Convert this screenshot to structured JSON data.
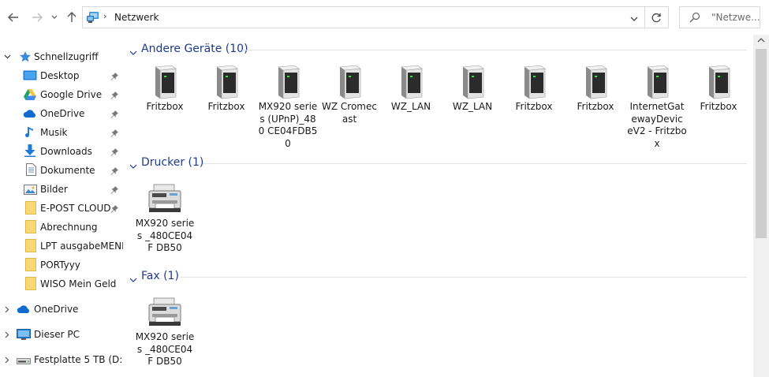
{
  "address_bar": {
    "path": "Netzwerk",
    "search_placeholder": "\"Netzwe..."
  },
  "sidebar": {
    "quick_access": "Schnellzugriff",
    "items": [
      {
        "label": "Desktop",
        "icon": "desktop-icon",
        "pinned": true
      },
      {
        "label": "Google Drive",
        "icon": "google-drive-icon",
        "pinned": true
      },
      {
        "label": "OneDrive",
        "icon": "onedrive-cloud-icon",
        "pinned": true
      },
      {
        "label": "Musik",
        "icon": "music-note-icon",
        "pinned": true
      },
      {
        "label": "Downloads",
        "icon": "download-arrow-icon",
        "pinned": true
      },
      {
        "label": "Dokumente",
        "icon": "document-icon",
        "pinned": true
      },
      {
        "label": "Bilder",
        "icon": "pictures-icon",
        "pinned": true
      },
      {
        "label": "E-POST CLOUD",
        "icon": "folder-icon",
        "pinned": true
      },
      {
        "label": "Abrechnung",
        "icon": "folder-icon",
        "pinned": false
      },
      {
        "label": "LPT ausgabeMENE1",
        "icon": "folder-icon",
        "pinned": false
      },
      {
        "label": "PORTyyy",
        "icon": "folder-icon",
        "pinned": false
      },
      {
        "label": "WISO Mein Geld",
        "icon": "folder-icon",
        "pinned": false
      }
    ],
    "roots": [
      {
        "label": "OneDrive",
        "icon": "onedrive-cloud-icon"
      },
      {
        "label": "Dieser PC",
        "icon": "computer-icon"
      },
      {
        "label": "Festplatte 5 TB (D:)",
        "icon": "drive-icon"
      }
    ]
  },
  "groups": [
    {
      "title": "Andere Geräte (10)",
      "items": [
        {
          "label": "Fritzbox",
          "icon": "network-device-icon"
        },
        {
          "label": "Fritzbox",
          "icon": "network-device-icon"
        },
        {
          "label": "MX920 series (UPnP)_480 CE04FDB50",
          "icon": "network-device-icon"
        },
        {
          "label": "WZ Cromecast",
          "icon": "network-device-icon"
        },
        {
          "label": "WZ_LAN",
          "icon": "network-device-icon"
        },
        {
          "label": "WZ_LAN",
          "icon": "network-device-icon"
        },
        {
          "label": "Fritzbox",
          "icon": "network-device-icon"
        },
        {
          "label": "Fritzbox",
          "icon": "network-device-icon"
        },
        {
          "label": "InternetGat ewayDevic eV2 - Fritzbox",
          "icon": "network-device-icon"
        },
        {
          "label": "Fritzbox",
          "icon": "network-device-icon"
        }
      ]
    },
    {
      "title": "Drucker (1)",
      "items": [
        {
          "label": "MX920 series _480CE04F DB50",
          "icon": "printer-icon"
        }
      ]
    },
    {
      "title": "Fax (1)",
      "items": [
        {
          "label": "MX920 series _480CE04F DB50",
          "icon": "fax-printer-icon"
        }
      ]
    }
  ],
  "colors": {
    "group_title": "#1e3b8a",
    "accent": "#0078d7"
  }
}
